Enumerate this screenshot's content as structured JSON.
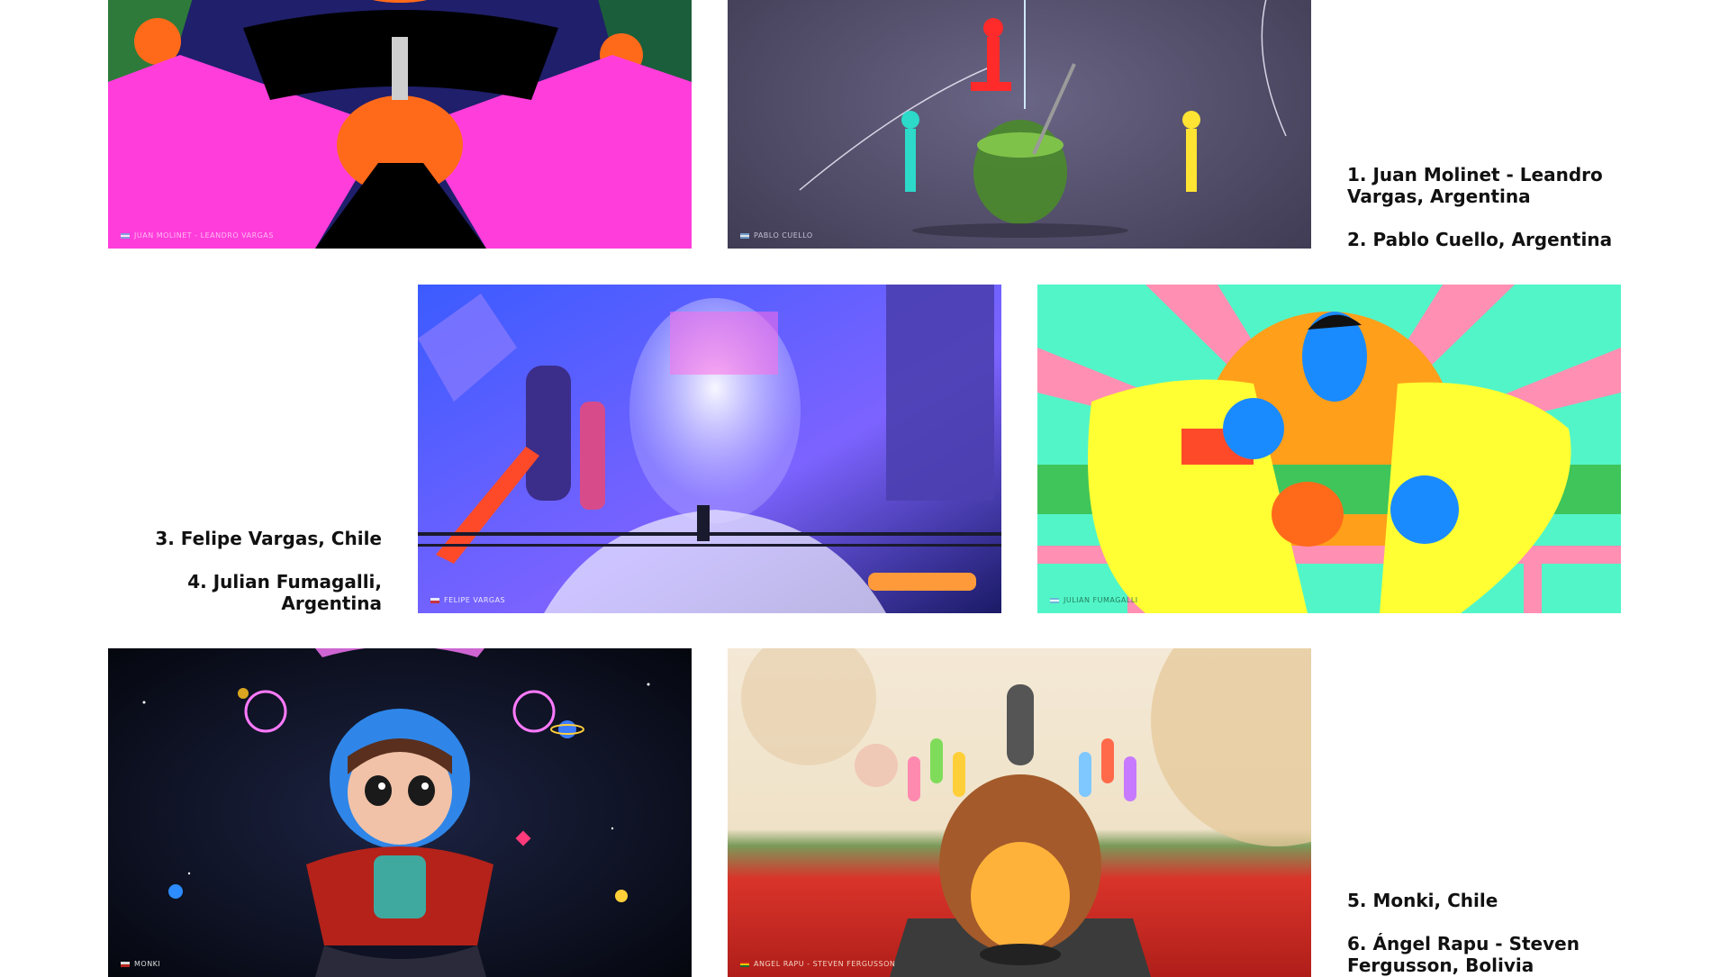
{
  "artworks": [
    {
      "id": 1,
      "credit": "JUAN MOLINET - LEANDRO VARGAS",
      "flag": "argentina"
    },
    {
      "id": 2,
      "credit": "PABLO CUELLO",
      "flag": "argentina"
    },
    {
      "id": 3,
      "credit": "FELIPE VARGAS",
      "flag": "chile"
    },
    {
      "id": 4,
      "credit": "JULIAN FUMAGALLI",
      "flag": "argentina"
    },
    {
      "id": 5,
      "credit": "MONKI",
      "flag": "chile"
    },
    {
      "id": 6,
      "credit": "ANGEL RAPU - STEVEN FERGUSSON",
      "flag": "bolivia"
    }
  ],
  "captions": {
    "row1": {
      "item1": "1. Juan Molinet - Leandro Vargas, Argentina",
      "item2": "2. Pablo Cuello, Argentina"
    },
    "row2": {
      "item3": "3. Felipe Vargas, Chile",
      "item4": "4. Julian Fumagalli, Argentina"
    },
    "row3": {
      "item5": "5. Monki, Chile",
      "item6": "6. Ángel Rapu - Steven Fergusson, Bolivia"
    }
  },
  "colors": {
    "background": "#ffffff",
    "text": "#111111"
  }
}
